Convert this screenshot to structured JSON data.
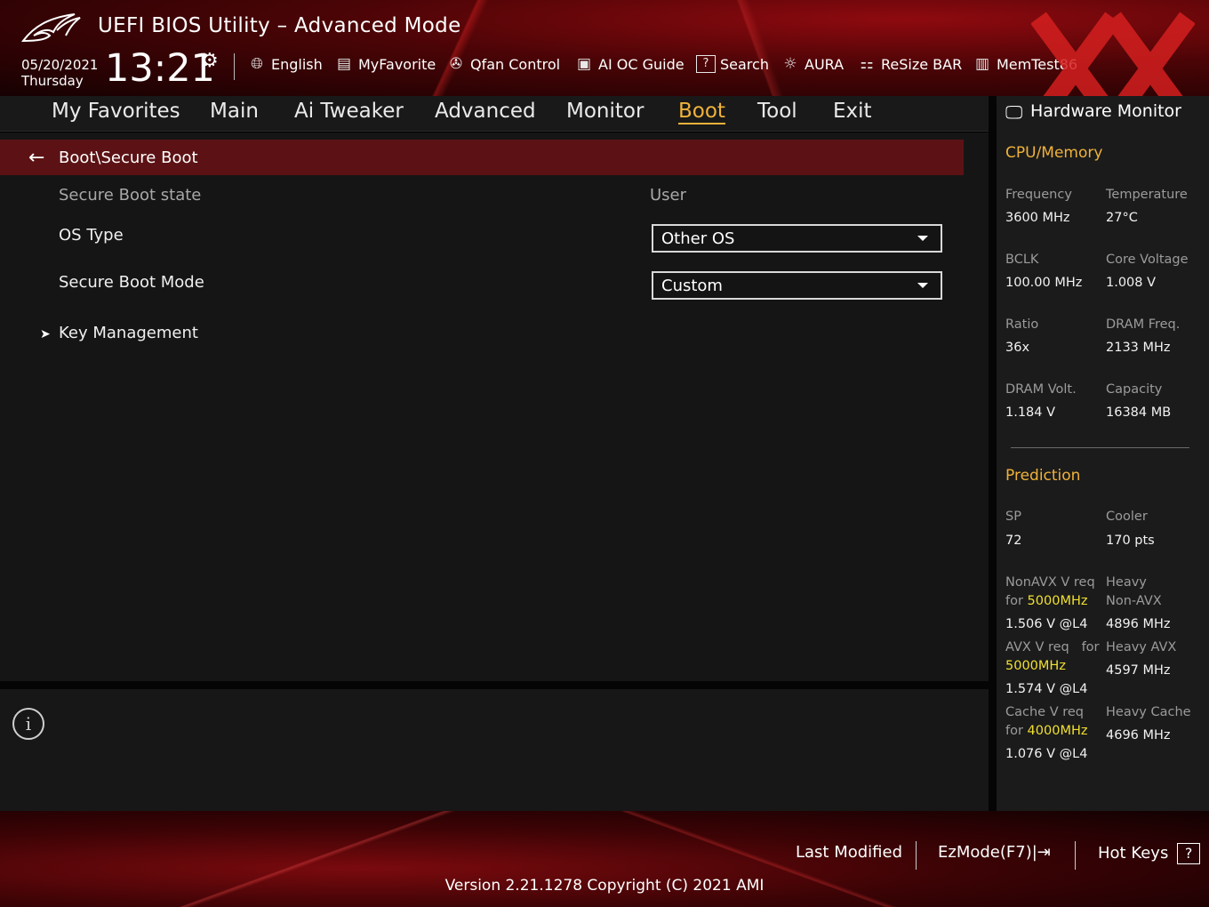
{
  "header": {
    "title": "UEFI BIOS Utility – Advanced Mode",
    "date": "05/20/2021",
    "day": "Thursday",
    "time": "13:21"
  },
  "toolbar": {
    "items": [
      {
        "label": "English",
        "icon": "globe-icon"
      },
      {
        "label": "MyFavorite",
        "icon": "favorite-list-icon"
      },
      {
        "label": "Qfan Control",
        "icon": "fan-icon"
      },
      {
        "label": "AI OC Guide",
        "icon": "chip-icon"
      },
      {
        "label": "Search",
        "icon": "help-search-icon"
      },
      {
        "label": "AURA",
        "icon": "aura-light-icon"
      },
      {
        "label": "ReSize BAR",
        "icon": "resize-bar-icon"
      },
      {
        "label": "MemTest86",
        "icon": "memory-icon"
      }
    ]
  },
  "tabs": [
    {
      "label": "My Favorites"
    },
    {
      "label": "Main"
    },
    {
      "label": "Ai Tweaker"
    },
    {
      "label": "Advanced"
    },
    {
      "label": "Monitor"
    },
    {
      "label": "Boot",
      "active": true
    },
    {
      "label": "Tool"
    },
    {
      "label": "Exit"
    }
  ],
  "breadcrumb": "Boot\\Secure Boot",
  "settings": {
    "secure_boot_state": {
      "label": "Secure Boot state",
      "value": "User"
    },
    "os_type": {
      "label": "OS Type",
      "value": "Other OS"
    },
    "secure_boot_mode": {
      "label": "Secure Boot Mode",
      "value": "Custom"
    },
    "key_management": {
      "label": "Key Management"
    }
  },
  "hardware_monitor": {
    "title": "Hardware Monitor",
    "cpu_memory": {
      "title": "CPU/Memory",
      "frequency_label": "Frequency",
      "frequency": "3600 MHz",
      "temperature_label": "Temperature",
      "temperature": "27°C",
      "bclk_label": "BCLK",
      "bclk": "100.00 MHz",
      "core_voltage_label": "Core Voltage",
      "core_voltage": "1.008 V",
      "ratio_label": "Ratio",
      "ratio": "36x",
      "dram_freq_label": "DRAM Freq.",
      "dram_freq": "2133 MHz",
      "dram_volt_label": "DRAM Volt.",
      "dram_volt": "1.184 V",
      "capacity_label": "Capacity",
      "capacity": "16384 MB"
    },
    "prediction": {
      "title": "Prediction",
      "sp_label": "SP",
      "sp": "72",
      "cooler_label": "Cooler",
      "cooler": "170 pts",
      "nonavx_label_1": "NonAVX V req",
      "nonavx_label_2": "for",
      "nonavx_freq": "5000MHz",
      "nonavx_value": "1.506 V @L4",
      "heavy_nonavx_label_1": "Heavy",
      "heavy_nonavx_label_2": "Non-AVX",
      "heavy_nonavx_value": "4896 MHz",
      "avx_label_1": "AVX V req",
      "avx_label_2": "for",
      "avx_freq": "5000MHz",
      "avx_value": "1.574 V @L4",
      "heavy_avx_label": "Heavy AVX",
      "heavy_avx_value": "4597 MHz",
      "cache_label_1": "Cache V req",
      "cache_label_2": "for",
      "cache_freq": "4000MHz",
      "cache_value": "1.076 V @L4",
      "heavy_cache_label": "Heavy Cache",
      "heavy_cache_value": "4696 MHz"
    }
  },
  "footer": {
    "last_modified": "Last Modified",
    "ezmode": "EzMode(F7)|",
    "hot_keys": "Hot Keys",
    "hot_keys_icon": "?",
    "version": "Version 2.21.1278 Copyright (C) 2021 AMI"
  },
  "colors": {
    "accent": "#f0b23a",
    "breadcrumb_bg": "#5c1214",
    "highlight": "#f0e030",
    "panel_bg": "#151515"
  }
}
